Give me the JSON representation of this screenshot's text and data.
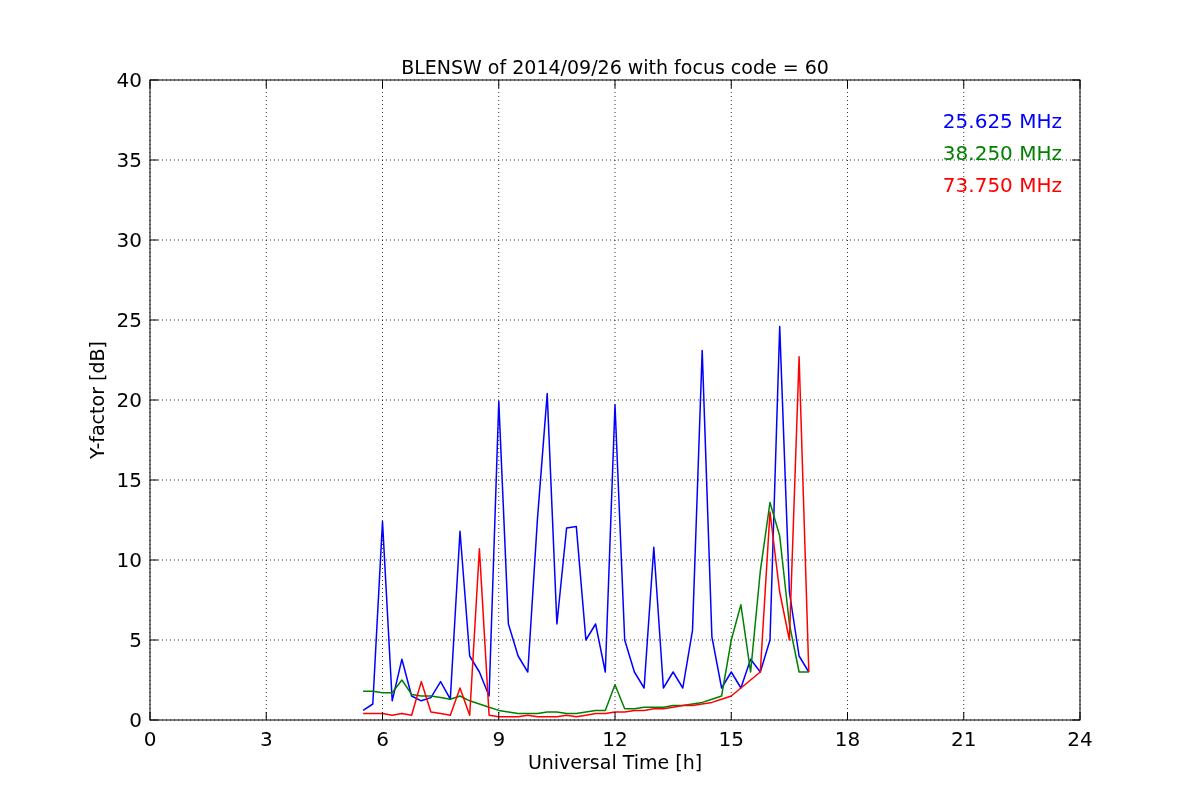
{
  "chart_data": {
    "type": "line",
    "title": "BLENSW of 2014/09/26 with focus code = 60",
    "xlabel": "Universal Time [h]",
    "ylabel": "Y-factor [dB]",
    "x": [
      5.5,
      5.75,
      6,
      6.25,
      6.5,
      6.75,
      7,
      7.25,
      7.5,
      7.75,
      8,
      8.25,
      8.5,
      8.75,
      9,
      9.25,
      9.5,
      9.75,
      10,
      10.25,
      10.5,
      10.75,
      11,
      11.25,
      11.5,
      11.75,
      12,
      12.25,
      12.5,
      12.75,
      13,
      13.25,
      13.5,
      13.75,
      14,
      14.25,
      14.5,
      14.75,
      15,
      15.25,
      15.5,
      15.75,
      16,
      16.25,
      16.5,
      16.75,
      17
    ],
    "series": [
      {
        "name": "25.625 MHz",
        "color": "#0000ff",
        "values": [
          0.6,
          1,
          12.4,
          1.2,
          3.8,
          1.5,
          1.2,
          1.4,
          2.4,
          1.3,
          11.8,
          4,
          3,
          1.5,
          19.9,
          6,
          4,
          3,
          12.6,
          20.4,
          6,
          12,
          12.1,
          5,
          6,
          3,
          19.7,
          5,
          3,
          2,
          10.8,
          2,
          3,
          2,
          5.6,
          23.1,
          5.2,
          2,
          3,
          2,
          3.8,
          3,
          5,
          24.6,
          8,
          4,
          3
        ]
      },
      {
        "name": "38.250 MHz",
        "color": "#008000",
        "values": [
          1.8,
          1.8,
          1.7,
          1.7,
          2.5,
          1.6,
          1.5,
          1.5,
          1.4,
          1.3,
          1.5,
          1.2,
          1.0,
          0.8,
          0.6,
          0.5,
          0.4,
          0.4,
          0.4,
          0.5,
          0.5,
          0.4,
          0.4,
          0.5,
          0.6,
          0.6,
          2.2,
          0.7,
          0.7,
          0.8,
          0.8,
          0.8,
          0.9,
          0.9,
          1.0,
          1.1,
          1.3,
          1.5,
          5.0,
          7.2,
          3,
          9.3,
          13.6,
          11.5,
          6,
          3,
          3
        ]
      },
      {
        "name": "73.750 MHz",
        "color": "#ff0000",
        "values": [
          0.4,
          0.4,
          0.4,
          0.3,
          0.4,
          0.3,
          2.4,
          0.5,
          0.4,
          0.3,
          2,
          0.3,
          10.7,
          0.3,
          0.2,
          0.2,
          0.2,
          0.3,
          0.2,
          0.2,
          0.2,
          0.3,
          0.2,
          0.3,
          0.4,
          0.4,
          0.5,
          0.5,
          0.6,
          0.6,
          0.7,
          0.7,
          0.8,
          0.9,
          0.9,
          1.0,
          1.1,
          1.3,
          1.5,
          2,
          2.5,
          3,
          13,
          8,
          5,
          22.7,
          3
        ]
      }
    ],
    "xlim": [
      0,
      24
    ],
    "ylim": [
      0,
      40
    ],
    "xticks": [
      0,
      3,
      6,
      9,
      12,
      15,
      18,
      21,
      24
    ],
    "yticks": [
      0,
      5,
      10,
      15,
      20,
      25,
      30,
      35,
      40
    ],
    "grid": true
  }
}
